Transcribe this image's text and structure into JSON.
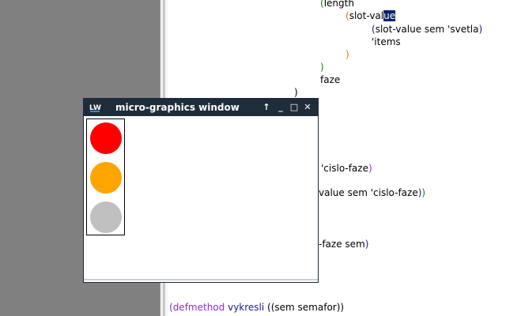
{
  "window": {
    "title": "micro-graphics window",
    "buttons": {
      "up": "↑",
      "minimize": "_",
      "maximize": "□",
      "close": "✕"
    },
    "lights": [
      {
        "name": "red",
        "color": "#ff0000"
      },
      {
        "name": "orange",
        "color": "#ffa500"
      },
      {
        "name": "gray",
        "color": "#c0c0c0"
      }
    ]
  },
  "code": {
    "line1": {
      "open": "(",
      "text": "length"
    },
    "line2": {
      "open": "(",
      "text": "slot-val",
      "sel": "ue"
    },
    "line3": {
      "open": "(",
      "text": "slot-value sem 'svetla",
      "close": ")"
    },
    "line4": {
      "text": "'items"
    },
    "line5": {
      "close": ")"
    },
    "line6": {
      "close": ")"
    },
    "line7": {
      "text": "faze"
    },
    "line8": {
      "close": ")"
    },
    "line9": {
      "text": "'cislo-faze",
      "close": ")"
    },
    "line10": {
      "text": "value sem 'cislo-faze",
      "close1": ")",
      "close2": ")"
    },
    "line11": {
      "text": "-faze sem",
      "close": ")"
    },
    "line12": {
      "open": "(",
      "keyword": "defmethod",
      "name": "vykresli",
      "args": " ((sem semafor))"
    }
  }
}
